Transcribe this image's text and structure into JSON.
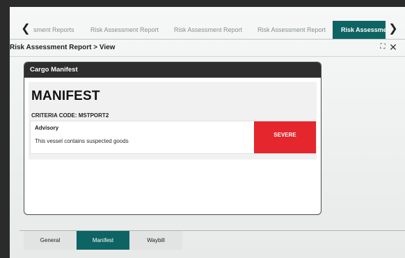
{
  "tabs": {
    "prev_icon": "chevron-left",
    "next_icon": "chevron-right",
    "items": [
      {
        "label": "sment Reports"
      },
      {
        "label": "Risk Assessment Report"
      },
      {
        "label": "Risk Assessment Report"
      },
      {
        "label": "Risk Assessment Report"
      },
      {
        "label": "Risk Assessment",
        "active": true
      }
    ],
    "active_color": "#0e6363"
  },
  "header": {
    "title": "Risk Assessment Report > View",
    "expand_icon": "expand-icon",
    "close_icon": "close-icon"
  },
  "card": {
    "title": "Cargo Manifest",
    "heading": "MANIFEST",
    "criteria": "CRITERIA CODE: MSTPORT2",
    "advisory": {
      "label": "Advisory",
      "text": "This vessel contains suspected goods",
      "severity": "SEVERE",
      "severity_color": "#e5262d"
    }
  },
  "bottom_tabs": {
    "items": [
      {
        "label": "General"
      },
      {
        "label": "Manifest",
        "active": true
      },
      {
        "label": "Waybill"
      }
    ]
  }
}
